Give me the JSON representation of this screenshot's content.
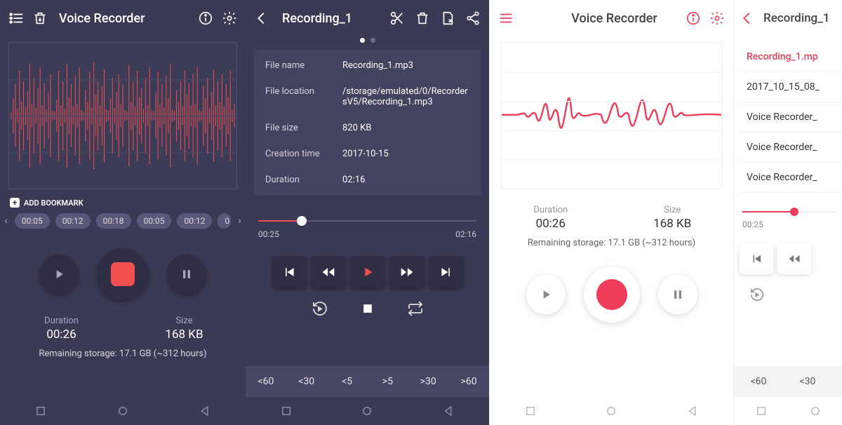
{
  "colors": {
    "accent_dark": "#f25050",
    "accent_light": "#ef3e5b"
  },
  "screen1": {
    "title": "Voice Recorder",
    "add_bookmark": "ADD BOOKMARK",
    "bookmarks": [
      "00:05",
      "00:12",
      "00:18",
      "00:05",
      "00:12",
      "0"
    ],
    "duration_label": "Duration",
    "duration_value": "00:26",
    "size_label": "Size",
    "size_value": "168 KB",
    "remaining": "Remaining storage: 17.1 GB (~312 hours)"
  },
  "screen2": {
    "title": "Recording_1",
    "info": {
      "file_name_k": "File name",
      "file_name_v": "Recording_1.mp3",
      "file_loc_k": "File location",
      "file_loc_v": "/storage/emulated/0/RecordersV5/Recording_1.mp3",
      "file_size_k": "File size",
      "file_size_v": "820 KB",
      "creation_k": "Creation time",
      "creation_v": "2017-10-15",
      "duration_k": "Duration",
      "duration_v": "02:16"
    },
    "seek_current": "00:25",
    "seek_total": "02:16",
    "skips": [
      "<60",
      "<30",
      "<5",
      ">5",
      ">30",
      ">60"
    ]
  },
  "screen3": {
    "title": "Voice Recorder",
    "duration_label": "Duration",
    "duration_value": "00:26",
    "size_label": "Size",
    "size_value": "168 KB",
    "remaining": "Remaining storage: 17.1 GB (~312 hours)"
  },
  "screen4": {
    "title": "Recording_1",
    "list": [
      "Recording_1.mp",
      "2017_10_15_08_",
      "Voice Recorder_",
      "Voice Recorder_",
      "Voice Recorder_"
    ],
    "seek_current": "00:25",
    "skips": [
      "<60",
      "<30"
    ]
  }
}
